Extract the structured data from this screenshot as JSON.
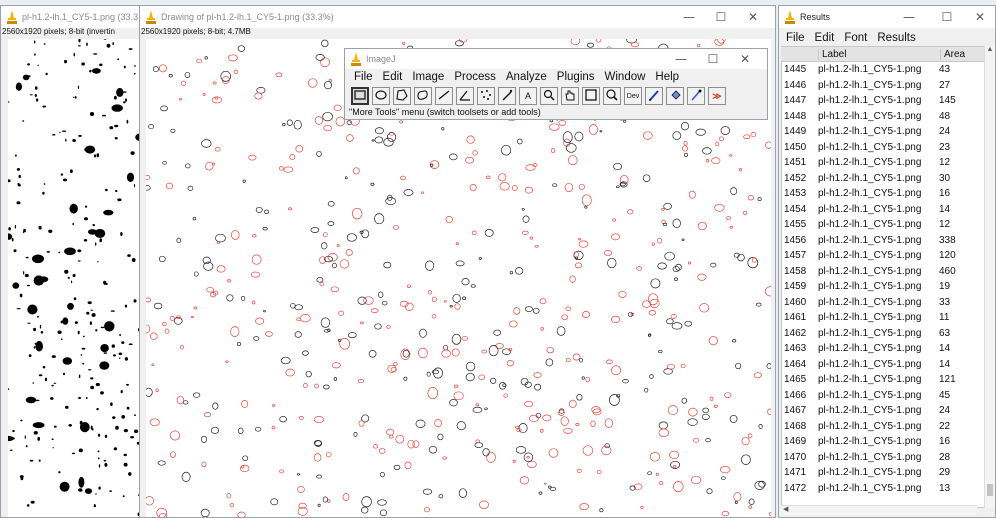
{
  "theme": {
    "selection_color": "#e8483c",
    "window_bg": "#f0f0f0",
    "icon_accent": "#f5b400"
  },
  "mask_window": {
    "title": "pl-h1.2-lh.1_CY5-1.png (33.3",
    "info": "2560x1920 pixels; 8-bit (invertin"
  },
  "drawing_window": {
    "title": "Drawing of pl-h1.2-lh.1_CY5-1.png (33.3%)",
    "info": "2560x1920 pixels; 8-bit; 4.7MB",
    "controls": {
      "minimize": "—",
      "maximize": "☐",
      "close": "✕"
    }
  },
  "imagej_window": {
    "title": "ImageJ",
    "menu": [
      "File",
      "Edit",
      "Image",
      "Process",
      "Analyze",
      "Plugins",
      "Window",
      "Help"
    ],
    "tools": [
      {
        "name": "rectangle-tool-icon",
        "glyph": "",
        "active": true
      },
      {
        "name": "oval-tool-icon",
        "glyph": ""
      },
      {
        "name": "polygon-tool-icon",
        "glyph": ""
      },
      {
        "name": "freehand-tool-icon",
        "glyph": ""
      },
      {
        "name": "line-tool-icon",
        "glyph": ""
      },
      {
        "name": "angle-tool-icon",
        "glyph": ""
      },
      {
        "name": "point-tool-icon",
        "glyph": ""
      },
      {
        "name": "wand-tool-icon",
        "glyph": ""
      },
      {
        "name": "text-tool-icon",
        "glyph": "A"
      },
      {
        "name": "zoom-tool-icon",
        "glyph": ""
      },
      {
        "name": "hand-tool-icon",
        "glyph": ""
      },
      {
        "name": "color-picker-tool-icon",
        "glyph": ""
      },
      {
        "name": "magnifier-tool-icon",
        "glyph": ""
      },
      {
        "name": "developer-menu-tool-icon",
        "glyph": "Dev"
      },
      {
        "name": "pencil-tool-icon",
        "glyph": ""
      },
      {
        "name": "flood-fill-tool-icon",
        "glyph": ""
      },
      {
        "name": "dropper-tool-icon",
        "glyph": ""
      },
      {
        "name": "more-tools-icon",
        "glyph": "≫"
      }
    ],
    "status": "\"More Tools\" menu (switch toolsets or add tools)",
    "controls": {
      "minimize": "—",
      "maximize": "☐",
      "close": "✕"
    }
  },
  "results_window": {
    "title": "Results",
    "menu": [
      "File",
      "Edit",
      "Font",
      "Results"
    ],
    "controls": {
      "minimize": "—",
      "maximize": "☐",
      "close": "✕"
    },
    "columns": [
      "",
      "Label",
      "Area"
    ],
    "rows": [
      {
        "index": "1445",
        "label": "pl-h1.2-lh.1_CY5-1.png",
        "area": "43"
      },
      {
        "index": "1446",
        "label": "pl-h1.2-lh.1_CY5-1.png",
        "area": "27"
      },
      {
        "index": "1447",
        "label": "pl-h1.2-lh.1_CY5-1.png",
        "area": "145"
      },
      {
        "index": "1448",
        "label": "pl-h1.2-lh.1_CY5-1.png",
        "area": "48"
      },
      {
        "index": "1449",
        "label": "pl-h1.2-lh.1_CY5-1.png",
        "area": "24"
      },
      {
        "index": "1450",
        "label": "pl-h1.2-lh.1_CY5-1.png",
        "area": "23"
      },
      {
        "index": "1451",
        "label": "pl-h1.2-lh.1_CY5-1.png",
        "area": "12"
      },
      {
        "index": "1452",
        "label": "pl-h1.2-lh.1_CY5-1.png",
        "area": "30"
      },
      {
        "index": "1453",
        "label": "pl-h1.2-lh.1_CY5-1.png",
        "area": "16"
      },
      {
        "index": "1454",
        "label": "pl-h1.2-lh.1_CY5-1.png",
        "area": "14"
      },
      {
        "index": "1455",
        "label": "pl-h1.2-lh.1_CY5-1.png",
        "area": "12"
      },
      {
        "index": "1456",
        "label": "pl-h1.2-lh.1_CY5-1.png",
        "area": "338"
      },
      {
        "index": "1457",
        "label": "pl-h1.2-lh.1_CY5-1.png",
        "area": "120"
      },
      {
        "index": "1458",
        "label": "pl-h1.2-lh.1_CY5-1.png",
        "area": "460"
      },
      {
        "index": "1459",
        "label": "pl-h1.2-lh.1_CY5-1.png",
        "area": "19"
      },
      {
        "index": "1460",
        "label": "pl-h1.2-lh.1_CY5-1.png",
        "area": "33"
      },
      {
        "index": "1461",
        "label": "pl-h1.2-lh.1_CY5-1.png",
        "area": "11"
      },
      {
        "index": "1462",
        "label": "pl-h1.2-lh.1_CY5-1.png",
        "area": "63"
      },
      {
        "index": "1463",
        "label": "pl-h1.2-lh.1_CY5-1.png",
        "area": "14"
      },
      {
        "index": "1464",
        "label": "pl-h1.2-lh.1_CY5-1.png",
        "area": "14"
      },
      {
        "index": "1465",
        "label": "pl-h1.2-lh.1_CY5-1.png",
        "area": "121"
      },
      {
        "index": "1466",
        "label": "pl-h1.2-lh.1_CY5-1.png",
        "area": "45"
      },
      {
        "index": "1467",
        "label": "pl-h1.2-lh.1_CY5-1.png",
        "area": "24"
      },
      {
        "index": "1468",
        "label": "pl-h1.2-lh.1_CY5-1.png",
        "area": "22"
      },
      {
        "index": "1469",
        "label": "pl-h1.2-lh.1_CY5-1.png",
        "area": "16"
      },
      {
        "index": "1470",
        "label": "pl-h1.2-lh.1_CY5-1.png",
        "area": "28"
      },
      {
        "index": "1471",
        "label": "pl-h1.2-lh.1_CY5-1.png",
        "area": "29"
      },
      {
        "index": "1472",
        "label": "pl-h1.2-lh.1_CY5-1.png",
        "area": "13"
      }
    ]
  }
}
